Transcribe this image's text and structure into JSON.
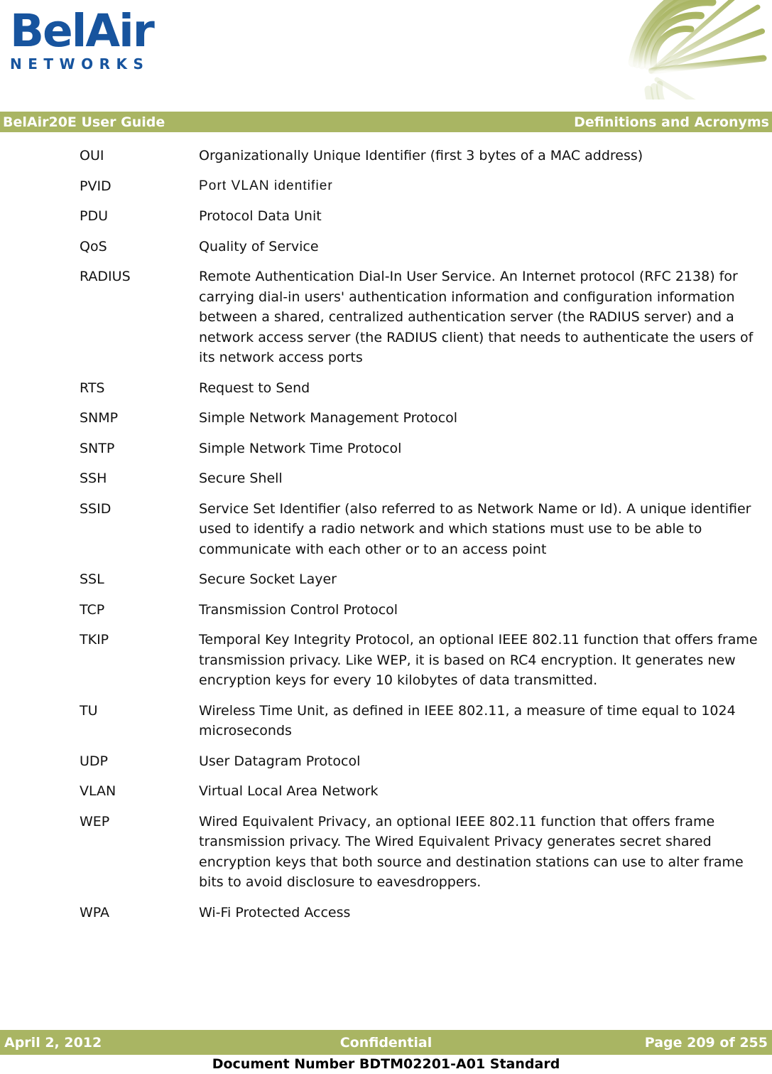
{
  "brand": {
    "logo_word": "BelAir",
    "logo_sub": "NETWORKS",
    "logo_color": "#17549E",
    "accent_color": "#A9B563",
    "graphic_name": "wireless-waves-graphic"
  },
  "header": {
    "document_title": "BelAir20E User Guide",
    "section_title": "Definitions and Acronyms"
  },
  "glossary": [
    {
      "term": "OUI",
      "definition": "Organizationally Unique Identifier (first 3 bytes of a MAC address)"
    },
    {
      "term": "PVID",
      "definition": "Port VLAN identifier"
    },
    {
      "term": "PDU",
      "definition": "Protocol Data Unit"
    },
    {
      "term": "QoS",
      "definition": "Quality of Service"
    },
    {
      "term": "RADIUS",
      "definition": "Remote Authentication Dial-In User Service. An Internet protocol (RFC 2138) for carrying dial-in users' authentication information and configuration information between a shared, centralized authentication server (the RADIUS server) and a network access server (the RADIUS client) that needs to authenticate the users of its network access ports"
    },
    {
      "term": "RTS",
      "definition": "Request to Send"
    },
    {
      "term": "SNMP",
      "definition": "Simple Network Management Protocol"
    },
    {
      "term": "SNTP",
      "definition": "Simple Network Time Protocol"
    },
    {
      "term": "SSH",
      "definition": "Secure Shell"
    },
    {
      "term": "SSID",
      "definition": "Service Set Identifier (also referred to as Network Name or Id). A unique identifier used to identify a radio network and which stations must use to be able to communicate with each other or to an access point"
    },
    {
      "term": "SSL",
      "definition": "Secure Socket Layer"
    },
    {
      "term": "TCP",
      "definition": "Transmission Control Protocol"
    },
    {
      "term": "TKIP",
      "definition": "Temporal Key Integrity Protocol, an optional IEEE 802.11 function that offers frame transmission privacy. Like WEP, it is based on RC4 encryption. It generates new encryption keys for every 10 kilobytes of data transmitted."
    },
    {
      "term": "TU",
      "definition": "Wireless Time Unit, as defined in IEEE 802.11, a measure of time equal to 1024 microseconds"
    },
    {
      "term": "UDP",
      "definition": "User Datagram Protocol"
    },
    {
      "term": "VLAN",
      "definition": "Virtual Local Area Network"
    },
    {
      "term": "WEP",
      "definition": "Wired Equivalent Privacy, an optional IEEE 802.11 function that offers frame transmission privacy. The Wired Equivalent Privacy generates secret shared encryption keys that both source and destination stations can use to alter frame bits to avoid disclosure to eavesdroppers."
    },
    {
      "term": "WPA",
      "definition": "Wi-Fi Protected Access"
    }
  ],
  "footer": {
    "date": "April 2, 2012",
    "classification": "Confidential",
    "page_label": "Page 209 of 255",
    "document_number": "Document Number BDTM02201-A01 Standard"
  }
}
